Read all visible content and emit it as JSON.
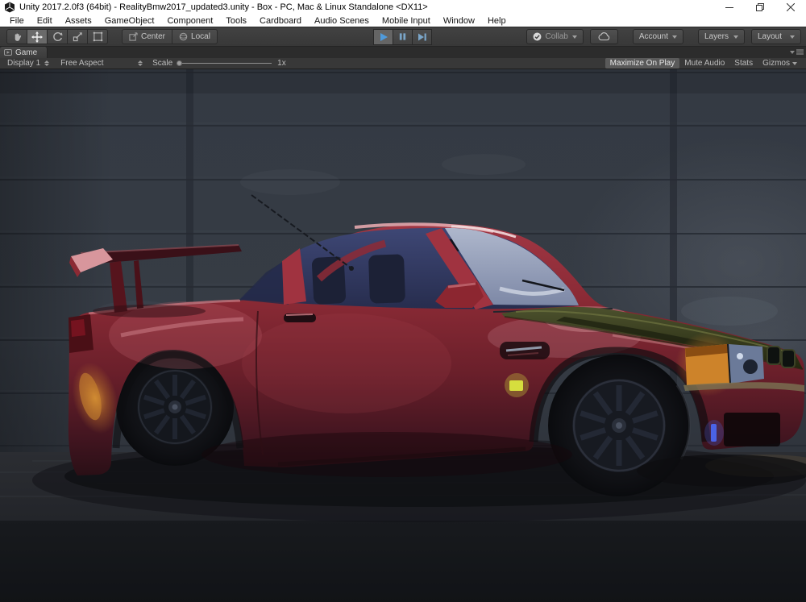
{
  "window": {
    "title": "Unity 2017.2.0f3 (64bit) - RealityBmw2017_updated3.unity - Box - PC, Mac & Linux Standalone <DX11>"
  },
  "menubar": {
    "items": [
      "File",
      "Edit",
      "Assets",
      "GameObject",
      "Component",
      "Tools",
      "Cardboard",
      "Audio Scenes",
      "Mobile Input",
      "Window",
      "Help"
    ]
  },
  "toolbar": {
    "center_label": "Center",
    "local_label": "Local",
    "collab_label": "Collab",
    "account_label": "Account",
    "layers_label": "Layers",
    "layout_label": "Layout"
  },
  "game_panel": {
    "tab_label": "Game",
    "display_label": "Display 1",
    "aspect_label": "Free Aspect",
    "scale_label": "Scale",
    "scale_value": "1x",
    "maximize_on_play_label": "Maximize On Play",
    "mute_audio_label": "Mute Audio",
    "stats_label": "Stats",
    "gizmos_label": "Gizmos"
  },
  "scene": {
    "colors": {
      "wall": "#363c45",
      "ground": "#24262b",
      "car_body": "#7e222c",
      "car_body_highlight": "#c4636d",
      "car_hood_green": "#3c4126",
      "side_glass": "#313a5e",
      "windshield": "#9aa5bf",
      "pillar_red": "#a03340",
      "headlight_amber": "#cd832a",
      "side_marker_yellow": "#d6de3e",
      "bumper_glow_blue": "#4a63e8",
      "wheel_dark": "#14161b"
    }
  }
}
